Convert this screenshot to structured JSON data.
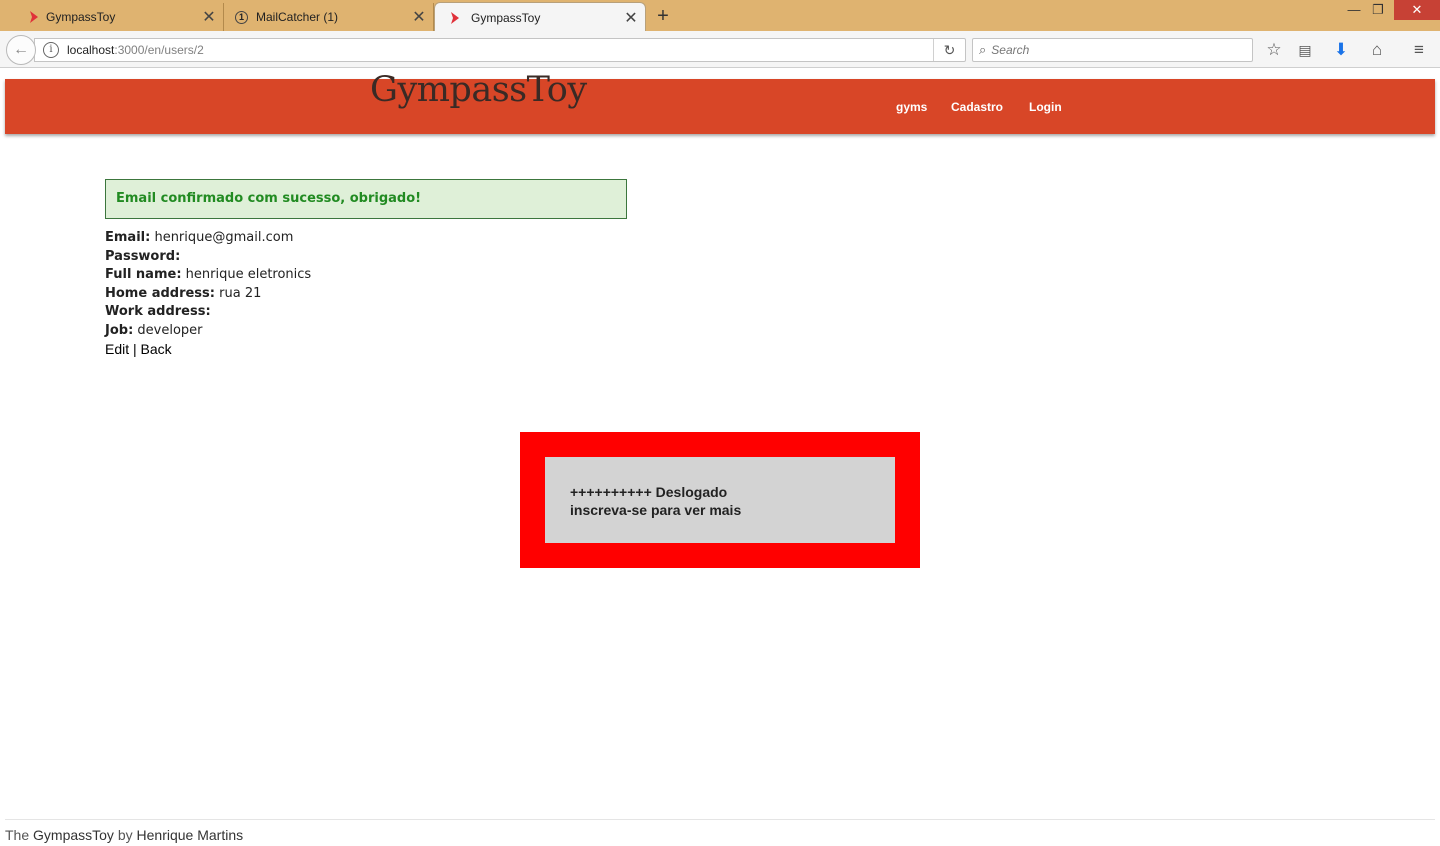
{
  "tabs": [
    {
      "label": "GympassToy",
      "icon": "ruby-icon",
      "active": false
    },
    {
      "label": "MailCatcher (1)",
      "icon": "badge-icon",
      "badge": "1",
      "active": false
    },
    {
      "label": "GympassToy",
      "icon": "ruby-icon",
      "active": true
    }
  ],
  "browser": {
    "url_host": "localhost",
    "url_path": ":3000/en/users/2",
    "search_placeholder": "Search"
  },
  "site": {
    "title": "GympassToy",
    "nav": [
      "gyms",
      "Cadastro",
      "Login"
    ]
  },
  "flash": "Email confirmado com sucesso, obrigado!",
  "user": {
    "email_label": "Email:",
    "email": "henrique@gmail.com",
    "password_label": "Password:",
    "password": "",
    "full_name_label": "Full name:",
    "full_name": "henrique eletronics",
    "home_address_label": "Home address:",
    "home_address": "rua 21",
    "work_address_label": "Work address:",
    "work_address": "",
    "job_label": "Job:",
    "job": "developer"
  },
  "actions": {
    "edit": "Edit",
    "separator": "|",
    "back": "Back"
  },
  "logout_box": {
    "line1": "++++++++++ Deslogado",
    "line2": "inscreva-se para ver mais"
  },
  "footer": {
    "prefix": "The",
    "app": "GympassToy",
    "by": "by",
    "author": "Henrique Martins"
  },
  "colors": {
    "header": "#d84627",
    "logout_outer": "#ff0000",
    "logout_inner": "#d3d3d3",
    "flash_bg": "#dff0d8",
    "flash_text": "#228b22",
    "titlebar": "#dfb370"
  }
}
